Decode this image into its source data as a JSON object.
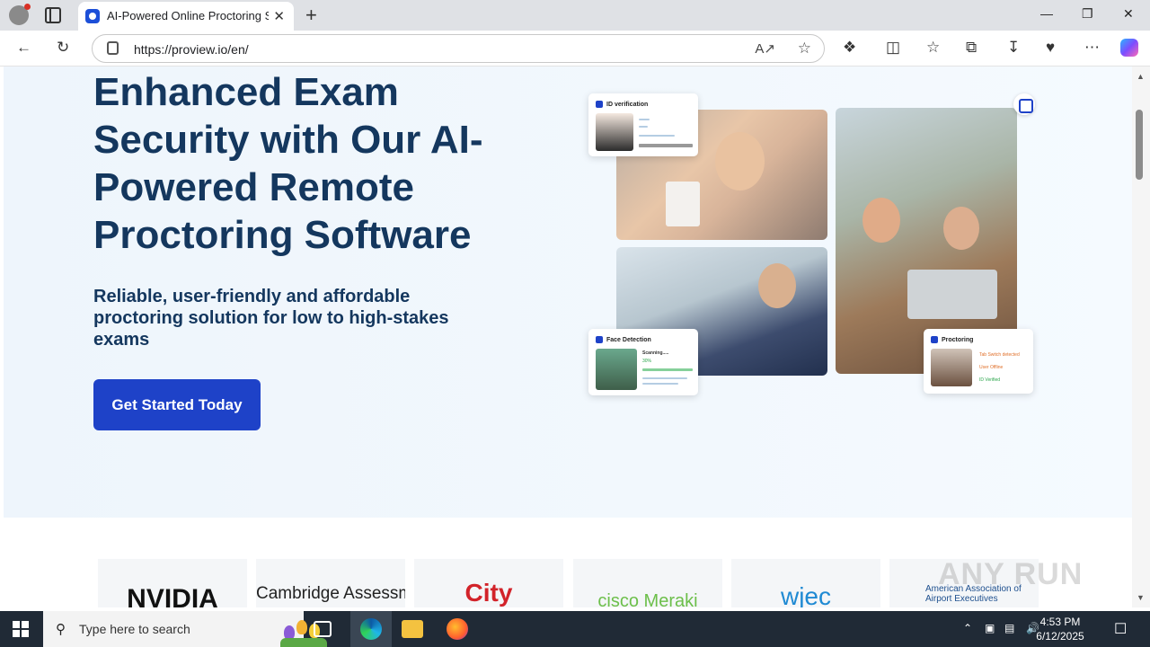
{
  "browser": {
    "tab_title": "AI-Powered Online Proctoring Sof",
    "url": "https://proview.io/en/",
    "new_tab_symbol": "+",
    "close_tab_symbol": "✕"
  },
  "hero": {
    "title": "Enhanced Exam Security with Our AI-Powered Remote Proctoring Software",
    "subtitle": "Reliable, user-friendly and affordable proctoring solution for low to high-stakes exams",
    "cta_label": "Get Started Today"
  },
  "cards": {
    "id_verification": {
      "title": "ID verification"
    },
    "face_detection": {
      "title": "Face Detection",
      "status": "Scanning.....",
      "percent": "30%"
    },
    "proctoring": {
      "title": "Proctoring",
      "line1": "Tab Switch detected",
      "line2": "User Offline",
      "line3": "ID Verified"
    }
  },
  "logos": [
    "NVIDIA",
    "Cambridge Assessment",
    "City",
    "cisco Meraki",
    "wjec",
    "American Association of Airport Executives"
  ],
  "watermark": "ANY RUN",
  "taskbar": {
    "search_placeholder": "Type here to search",
    "time": "4:53 PM",
    "date": "6/12/2025"
  },
  "colors": {
    "brand_blue": "#1e42c8",
    "heading_navy": "#14375e"
  }
}
